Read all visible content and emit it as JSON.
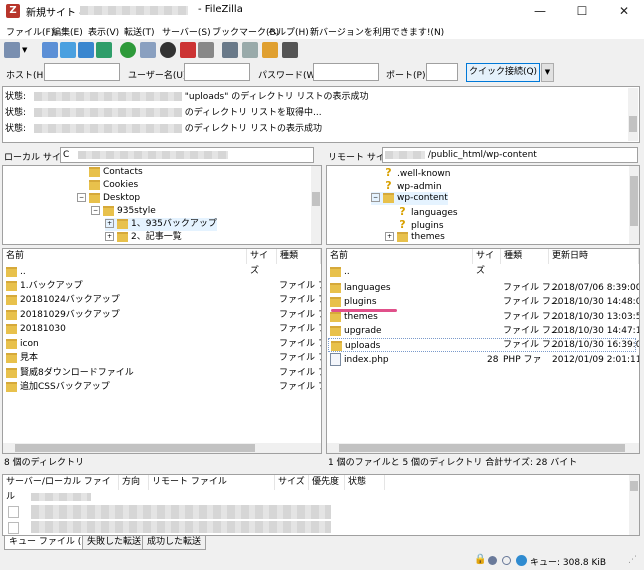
{
  "window": {
    "title_prefix": "新規サイト - ",
    "title_app": "- FileZilla",
    "minimize": "—",
    "maximize": "☐",
    "close": "✕"
  },
  "menu": [
    "ファイル(F)",
    "編集(E)",
    "表示(V)",
    "転送(T)",
    "サーバー(S)",
    "ブックマーク(B)",
    "ヘルプ(H)",
    "新バージョンを利用できます!(N)"
  ],
  "quickconnect": {
    "host_label": "ホスト(H):",
    "user_label": "ユーザー名(U):",
    "pass_label": "パスワード(W):",
    "port_label": "ポート(P):",
    "button": "クイック接続(Q)",
    "dropdown": "▼"
  },
  "log": [
    {
      "label": "状態:",
      "text": "\"uploads\" のディレクトリ リストの表示成功"
    },
    {
      "label": "状態:",
      "text": "のディレクトリ リストを取得中..."
    },
    {
      "label": "状態:",
      "text": "のディレクトリ リストの表示成功"
    }
  ],
  "local": {
    "site_label": "ローカル サイト:",
    "site_value": "C",
    "tree": [
      {
        "name": "Contacts",
        "indent": 1
      },
      {
        "name": "Cookies",
        "indent": 1
      },
      {
        "name": "Desktop",
        "indent": 1
      },
      {
        "name": "935style",
        "indent": 2
      },
      {
        "name": "1、935バックアップ",
        "indent": 3
      },
      {
        "name": "2、記事一覧",
        "indent": 3
      }
    ],
    "columns": {
      "name": "名前",
      "size": "サイズ",
      "type": "種類"
    },
    "rows": [
      {
        "name": "..",
        "type": ""
      },
      {
        "name": "1.バックアップ",
        "type": "ファイル フォ..."
      },
      {
        "name": "20181024バックアップ",
        "type": "ファイル フォ..."
      },
      {
        "name": "20181029バックアップ",
        "type": "ファイル フォ..."
      },
      {
        "name": "20181030",
        "type": "ファイル フォ..."
      },
      {
        "name": "icon",
        "type": "ファイル フォ..."
      },
      {
        "name": "見本",
        "type": "ファイル フォ..."
      },
      {
        "name": "賢威8ダウンロードファイル",
        "type": "ファイル フォ..."
      },
      {
        "name": "追加CSSバックアップ",
        "type": "ファイル フォ..."
      }
    ],
    "status": "8 個のディレクトリ"
  },
  "remote": {
    "site_label": "リモート サイト:",
    "site_value": "/public_html/wp-content",
    "tree": [
      {
        "name": ".well-known",
        "indent": 1,
        "icon": "q"
      },
      {
        "name": "wp-admin",
        "indent": 1,
        "icon": "q"
      },
      {
        "name": "wp-content",
        "indent": 1,
        "icon": "folder"
      },
      {
        "name": "languages",
        "indent": 2,
        "icon": "q"
      },
      {
        "name": "plugins",
        "indent": 2,
        "icon": "q"
      },
      {
        "name": "themes",
        "indent": 2,
        "icon": "folder"
      }
    ],
    "columns": {
      "name": "名前",
      "size": "サイズ",
      "type": "種類",
      "date": "更新日時"
    },
    "rows": [
      {
        "name": "..",
        "size": "",
        "type": "",
        "date": ""
      },
      {
        "name": "languages",
        "size": "",
        "type": "ファイル フ...",
        "date": "2018/07/06 8:39:00"
      },
      {
        "name": "plugins",
        "size": "",
        "type": "ファイル フ...",
        "date": "2018/10/30 14:48:02"
      },
      {
        "name": "themes",
        "size": "",
        "type": "ファイル フ...",
        "date": "2018/10/30 13:03:59"
      },
      {
        "name": "upgrade",
        "size": "",
        "type": "ファイル フ...",
        "date": "2018/10/30 14:47:16"
      },
      {
        "name": "uploads",
        "size": "",
        "type": "ファイル フ...",
        "date": "2018/10/30 16:39:09"
      },
      {
        "name": "index.php",
        "size": "28",
        "type": "PHP ファ",
        "date": "2012/01/09 2:01:11"
      }
    ],
    "status": "1 個のファイルと 5 個のディレクトリ 合計サイズ: 28 バイト"
  },
  "queue": {
    "columns": [
      "サーバー/ローカル ファイル",
      "方向",
      "リモート ファイル",
      "サイズ",
      "優先度",
      "状態"
    ],
    "tabs": [
      "キュー ファイル (33)",
      "失敗した転送",
      "成功した転送"
    ],
    "footer": "キュー: 308.8 KiB"
  },
  "colors": {
    "highlight_underline": "#e0508a",
    "accent": "#0078d7"
  }
}
